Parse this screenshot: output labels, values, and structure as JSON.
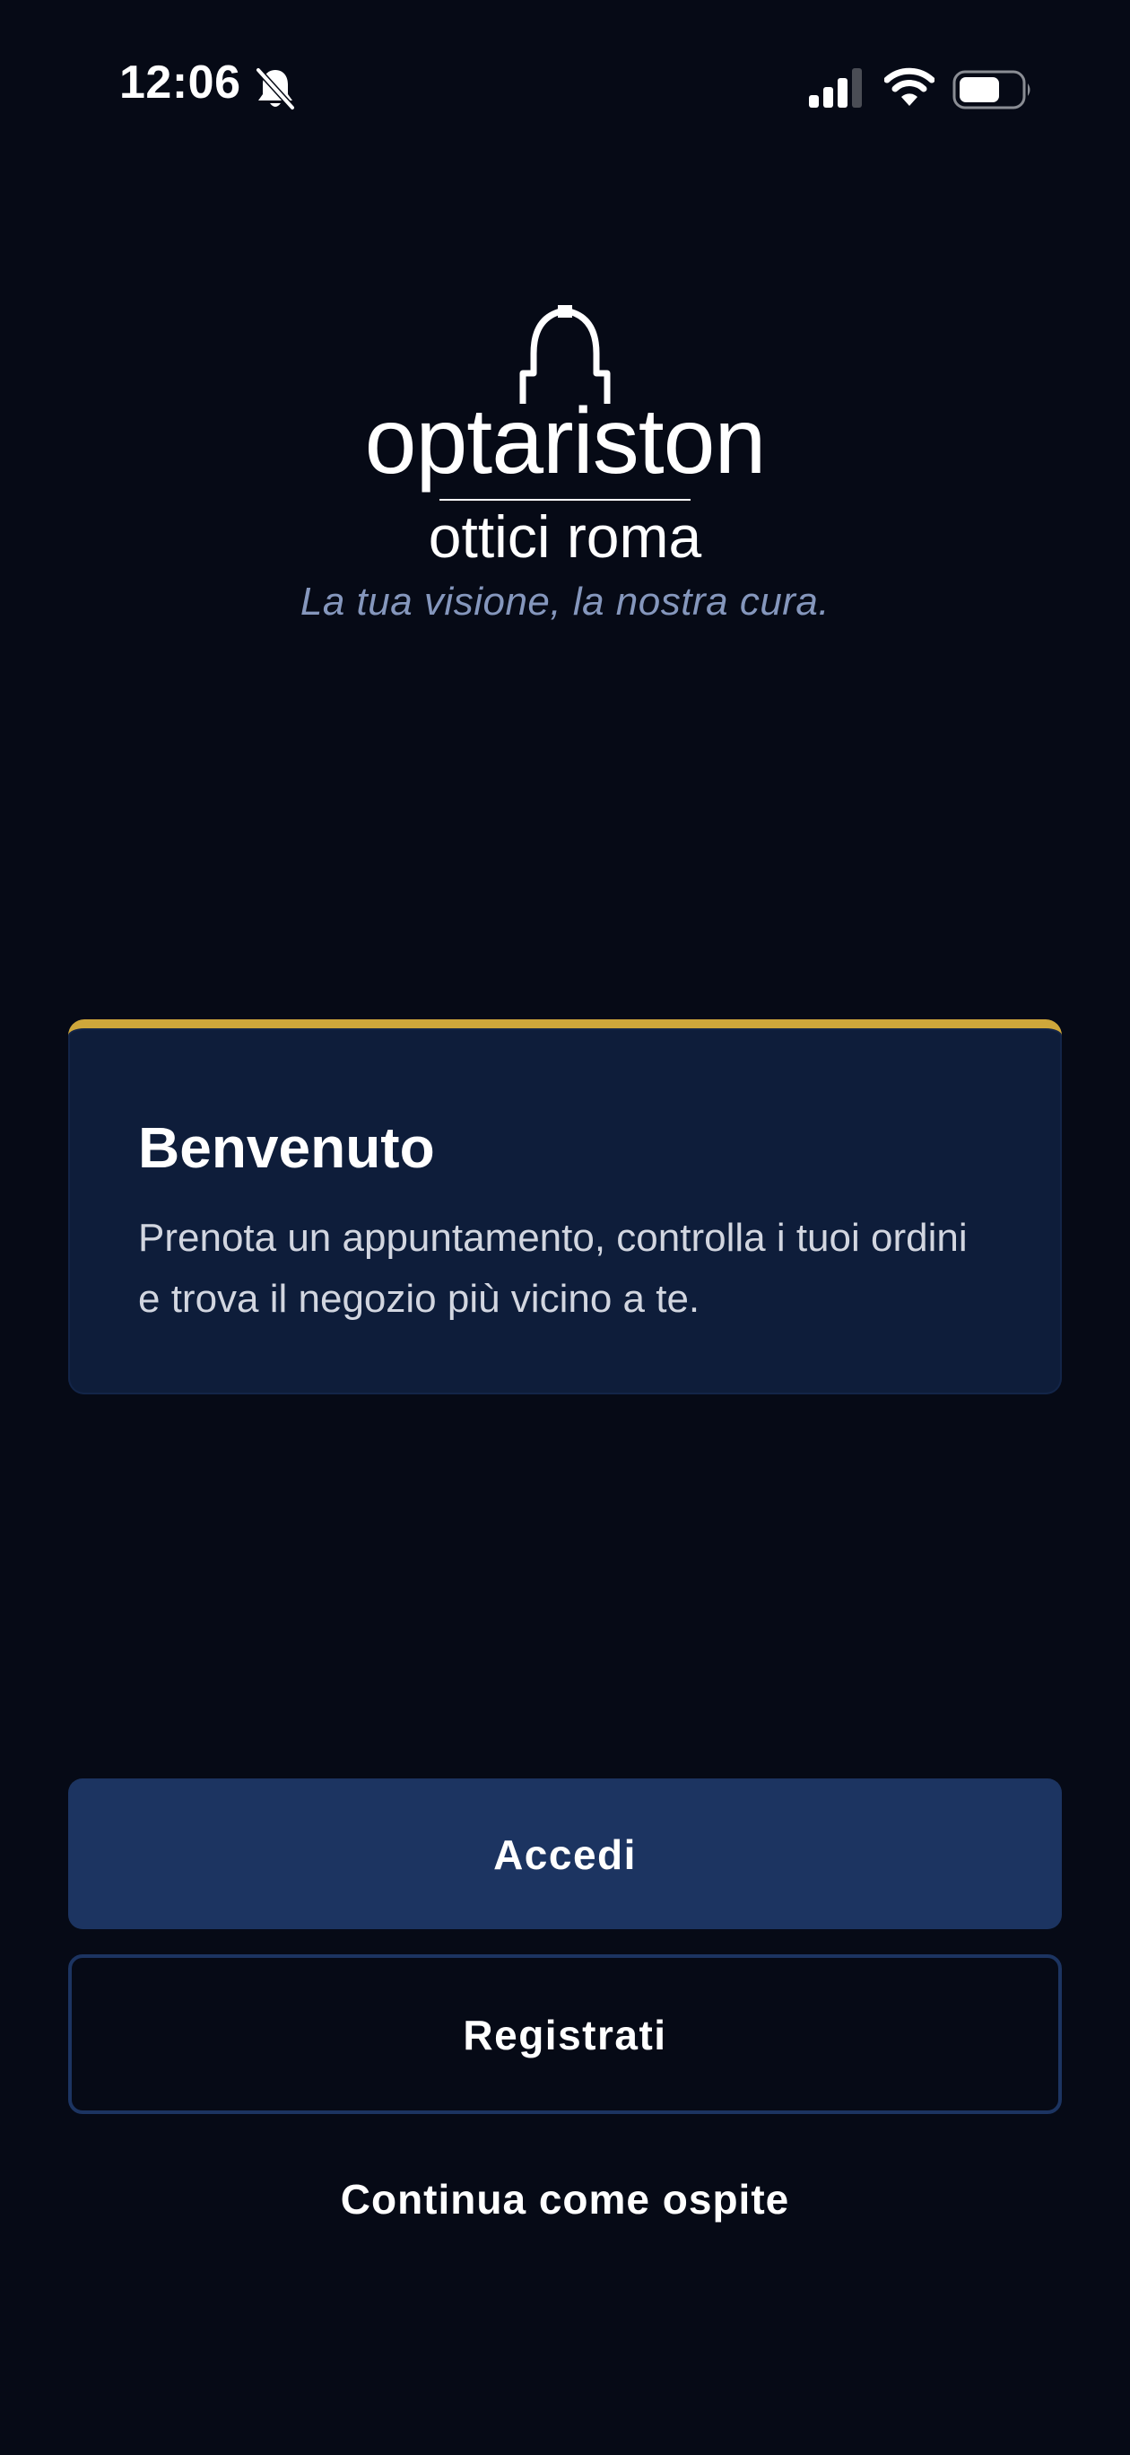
{
  "status_bar": {
    "time": "12:06",
    "icons": [
      "bell-slash-icon",
      "cellular-signal-icon",
      "wifi-icon",
      "battery-icon"
    ],
    "battery_level": 0.6
  },
  "brand": {
    "wordmark": "optariston",
    "subtitle": "ottici roma",
    "logo_icon": "dome-icon",
    "tagline": "La tua visione, la nostra cura."
  },
  "welcome_card": {
    "title": "Benvenuto",
    "text": "Prenota un appuntamento, controlla i tuoi ordini e trova il negozio più vicino a te.",
    "accent_color": "#cfa73b"
  },
  "actions": {
    "login_label": "Accedi",
    "register_label": "Registrati",
    "guest_label": "Continua come ospite"
  },
  "colors": {
    "background": "#060a16",
    "card": "#0e1d3a",
    "primary_button": "#1c3461",
    "tagline": "#8597bd"
  }
}
